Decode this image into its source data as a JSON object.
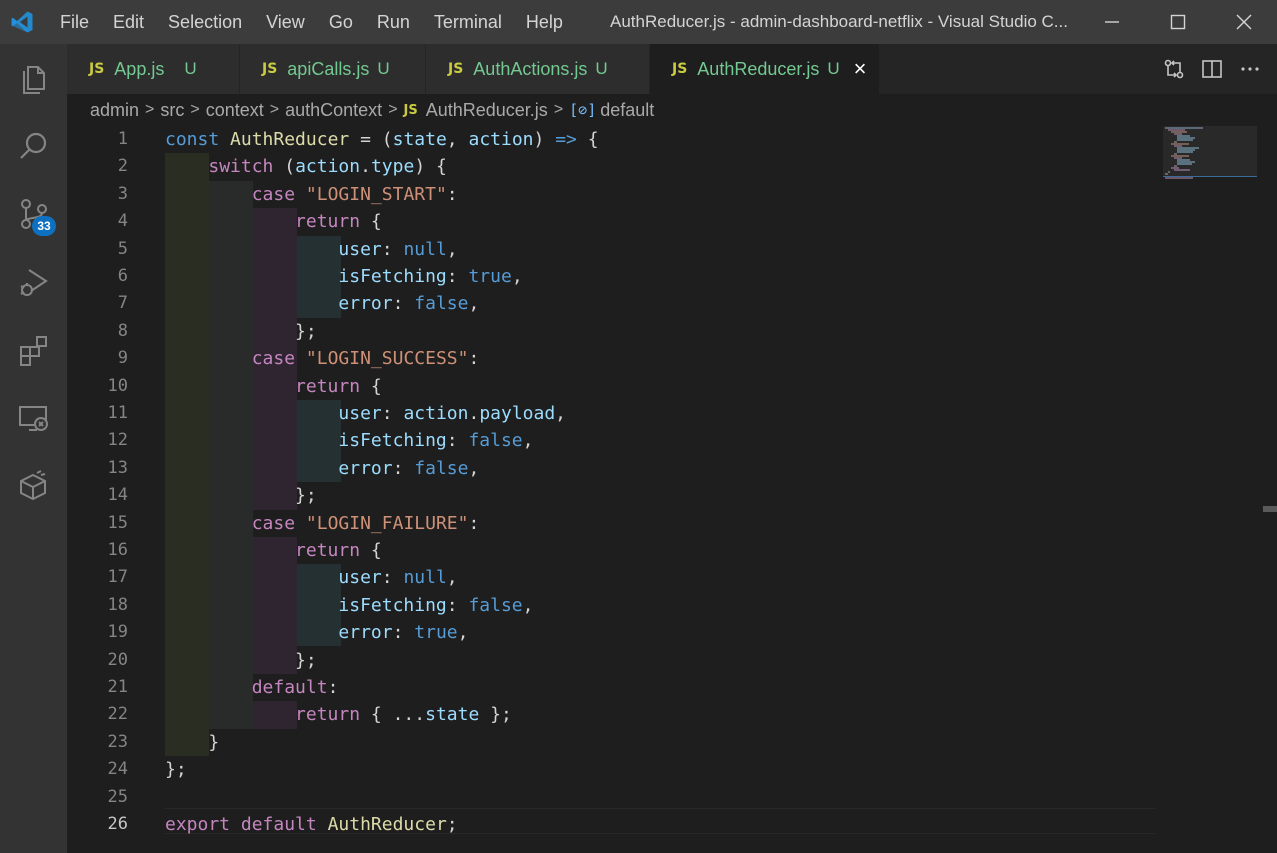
{
  "menu": {
    "items": [
      "File",
      "Edit",
      "Selection",
      "View",
      "Go",
      "Run",
      "Terminal",
      "Help"
    ]
  },
  "window_title": "AuthReducer.js - admin-dashboard-netflix - Visual Studio C...",
  "activity": {
    "source_control_badge": "33"
  },
  "tabs": [
    {
      "icon": "JS",
      "label": "App.js",
      "status": "U"
    },
    {
      "icon": "JS",
      "label": "apiCalls.js",
      "status": "U"
    },
    {
      "icon": "JS",
      "label": "AuthActions.js",
      "status": "U"
    },
    {
      "icon": "JS",
      "label": "AuthReducer.js",
      "status": "U"
    }
  ],
  "breadcrumb": {
    "parts": [
      "admin",
      "src",
      "context",
      "authContext"
    ],
    "file_icon": "JS",
    "file": "AuthReducer.js",
    "symbol_icon": "[⊘]",
    "symbol": "default"
  },
  "editor": {
    "line_numbers": [
      "1",
      "2",
      "3",
      "4",
      "5",
      "6",
      "7",
      "8",
      "9",
      "10",
      "11",
      "12",
      "13",
      "14",
      "15",
      "16",
      "17",
      "18",
      "19",
      "20",
      "21",
      "22",
      "23",
      "24",
      "25",
      "26"
    ],
    "current_line": "26"
  },
  "colors": {
    "keyword_blue": "#569cd6",
    "keyword_purple": "#c586c0",
    "function": "#dcdcaa",
    "variable": "#9cdcfe",
    "string": "#ce9178",
    "git_untracked": "#73c991",
    "js_icon": "#cbcb41",
    "badge": "#0e70c0"
  },
  "icons": [
    "vscode-logo-icon",
    "files-icon",
    "search-icon",
    "source-control-icon",
    "run-debug-icon",
    "extensions-icon",
    "remote-explorer-icon",
    "testing-icon",
    "compare-changes-icon",
    "split-editor-icon",
    "more-actions-icon",
    "minimize-icon",
    "maximize-icon",
    "close-icon"
  ]
}
